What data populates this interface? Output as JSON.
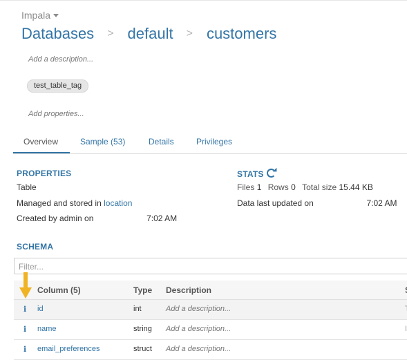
{
  "header": {
    "engine": "Impala",
    "breadcrumbs": [
      "Databases",
      "default",
      "customers"
    ],
    "separator": ">",
    "description_placeholder": "Add a description...",
    "tag": "test_table_tag",
    "properties_placeholder": "Add properties..."
  },
  "tabs": [
    {
      "label": "Overview",
      "active": true
    },
    {
      "label": "Sample (53)",
      "active": false
    },
    {
      "label": "Details",
      "active": false
    },
    {
      "label": "Privileges",
      "active": false
    }
  ],
  "properties": {
    "title": "PROPERTIES",
    "type": "Table",
    "managed_prefix": "Managed and stored in",
    "managed_link": "location",
    "created_prefix": "Created by admin on",
    "created_time": "7:02 AM"
  },
  "stats": {
    "title": "STATS",
    "files_label": "Files",
    "files_value": "1",
    "rows_label": "Rows",
    "rows_value": "0",
    "size_label": "Total size",
    "size_value": "15.44 KB",
    "updated_prefix": "Data last updated on",
    "updated_time": "7:02 AM"
  },
  "schema": {
    "title": "SCHEMA",
    "filter_placeholder": "Filter...",
    "columns": {
      "name": "Column (5)",
      "type": "Type",
      "description": "Description",
      "edge": "S"
    },
    "rows": [
      {
        "icon": "i",
        "name": "id",
        "type": "int",
        "description": "Add a description...",
        "edge": "T"
      },
      {
        "icon": "i",
        "name": "name",
        "type": "string",
        "description": "Add a description...",
        "edge": "I"
      },
      {
        "icon": "i",
        "name": "email_preferences",
        "type": "struct",
        "description": "Add a description...",
        "edge": ""
      }
    ]
  },
  "colors": {
    "accent": "#3375a6",
    "annotation_arrow": "#f0b323"
  }
}
